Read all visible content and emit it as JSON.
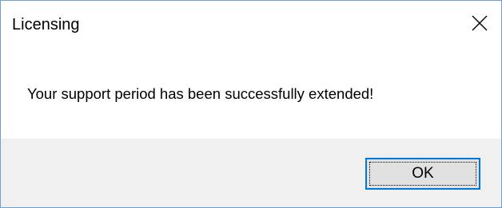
{
  "window": {
    "title": "Licensing",
    "close_icon": "close-icon"
  },
  "message": {
    "text": "Your support period has been successfully extended!"
  },
  "buttons": {
    "ok_label": "OK"
  },
  "colors": {
    "border_accent": "#6f9fd6",
    "button_focus": "#0078d7",
    "button_face": "#e1e1e1",
    "footer_background": "#f0f0f0"
  }
}
